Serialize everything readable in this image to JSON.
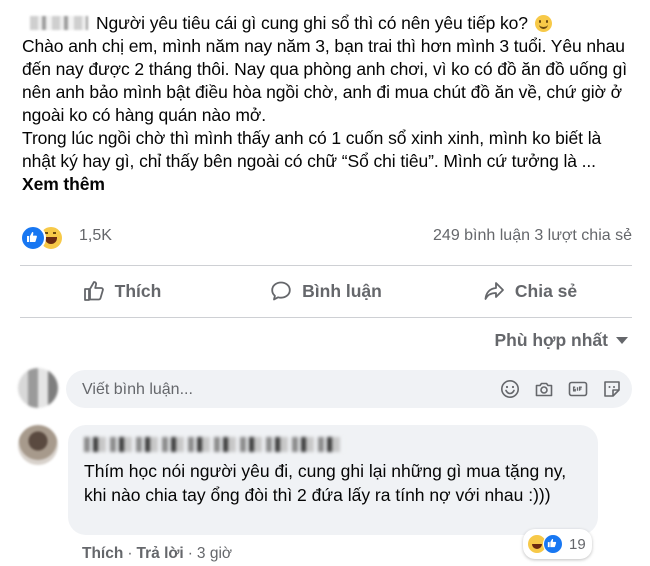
{
  "post": {
    "paragraphs": [
      "Người yêu tiêu cái gì cung ghi sổ thì có nên yêu tiếp ko?",
      "Chào anh chị em, mình năm nay năm 3, bạn trai thì hơn mình 3 tuổi. Yêu nhau đến nay được 2 tháng thôi. Nay qua phòng anh chơi, vì ko có đồ ăn đồ uống gì nên anh bảo mình bật điều hòa ngồi chờ, anh đi mua chút đồ ăn về, chứ giờ ở ngoài ko có hàng quán nào mở.",
      "Trong lúc ngồi chờ thì mình thấy anh có 1 cuốn sổ xinh xinh, mình ko biết là nhật ký hay gì, chỉ thấy bên ngoài có chữ “Sổ chi tiêu”. Mình cứ tưởng là ..."
    ],
    "see_more": "Xem thêm"
  },
  "stats": {
    "reactions": "1,5K",
    "comments": "249 bình luận",
    "shares": "3 lượt chia sẻ"
  },
  "actions": {
    "like": "Thích",
    "comment": "Bình luận",
    "share": "Chia sẻ"
  },
  "sort": {
    "label": "Phù hợp nhất"
  },
  "comment_input": {
    "placeholder": "Viết bình luận..."
  },
  "comment": {
    "text": "Thím học nói người yêu đi, cung ghi lại những gì mua tặng ny, khi nào chia tay ổng đòi thì 2 đứa lấy ra tính nợ với nhau :)))",
    "reaction_count": "19",
    "like_label": "Thích",
    "reply_label": "Trả lời",
    "separator": "·",
    "time": "3 giờ"
  },
  "colors": {
    "accent": "#1877f2",
    "secondary_text": "#65676b",
    "bubble_bg": "#f0f2f5",
    "divider": "#ced0d4"
  }
}
